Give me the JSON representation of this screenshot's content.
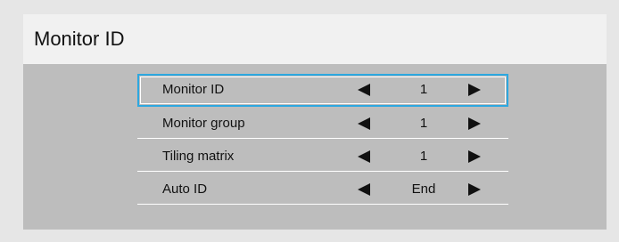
{
  "title": "Monitor ID",
  "menu": {
    "items": [
      {
        "label": "Monitor ID",
        "value": "1",
        "left_arrow": "left-arrow-icon",
        "right_arrow": "right-arrow-icon"
      },
      {
        "label": "Monitor group",
        "value": "1",
        "left_arrow": "left-arrow-icon",
        "right_arrow": "right-arrow-icon"
      },
      {
        "label": "Tiling matrix",
        "value": "1",
        "left_arrow": "left-arrow-icon",
        "right_arrow": "right-arrow-icon"
      },
      {
        "label": "Auto ID",
        "value": "End",
        "left_arrow": "left-arrow-icon",
        "right_arrow": "right-arrow-icon"
      }
    ],
    "selected_index": 0
  },
  "colors": {
    "selection_border": "#2da8e0",
    "panel_background": "#bdbdbd",
    "title_background": "#f1f1f1"
  }
}
